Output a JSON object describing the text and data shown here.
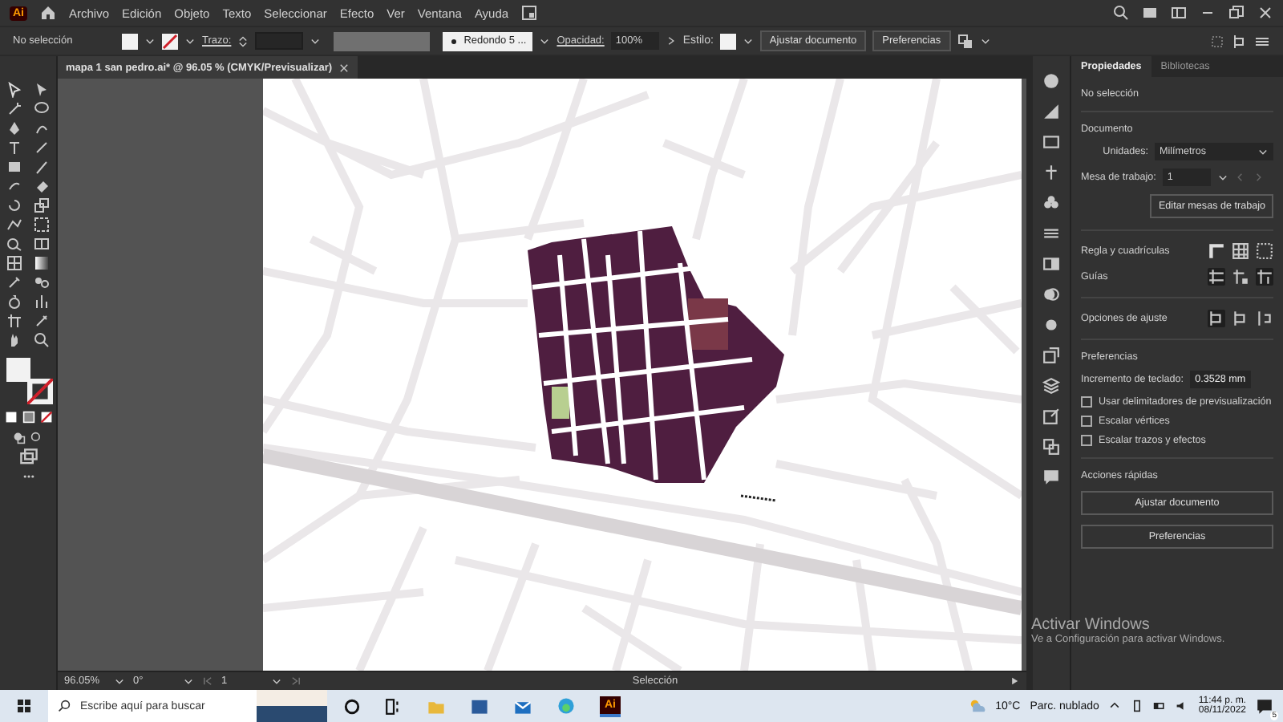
{
  "app": {
    "logo": "Ai",
    "menu": [
      "Archivo",
      "Edición",
      "Objeto",
      "Texto",
      "Seleccionar",
      "Efecto",
      "Ver",
      "Ventana",
      "Ayuda"
    ]
  },
  "control_bar": {
    "selection": "No selección",
    "stroke_label": "Trazo:",
    "brush": "Redondo 5 ...",
    "opacity_label": "Opacidad:",
    "opacity": "100%",
    "style_label": "Estilo:",
    "buttons": [
      "Ajustar documento",
      "Preferencias"
    ]
  },
  "document_tab": {
    "title": "mapa 1 san pedro.ai* @ 96.05 % (CMYK/Previsualizar)"
  },
  "panel": {
    "tabs": [
      {
        "label": "Propiedades",
        "selected": true
      },
      {
        "label": "Bibliotecas",
        "selected": false
      }
    ],
    "selection": "No selección",
    "document_heading": "Documento",
    "units_label": "Unidades:",
    "units": "Milímetros",
    "artboard_label": "Mesa de trabajo:",
    "artboard": "1",
    "edit_artboards": "Editar mesas de trabajo",
    "rulers_label": "Regla y cuadrículas",
    "guides_label": "Guías",
    "snap_label": "Opciones de ajuste",
    "preferences_heading": "Preferencias",
    "keyboard_increment_label": "Incremento de teclado:",
    "keyboard_increment": "0.3528 mm",
    "options": [
      {
        "label": "Usar delimitadores de previsualización",
        "checked": false
      },
      {
        "label": "Escalar vértices",
        "checked": false
      },
      {
        "label": "Escalar trazos y efectos",
        "checked": false
      }
    ],
    "quick_actions_heading": "Acciones rápidas",
    "quick_actions": [
      "Ajustar documento",
      "Preferencias"
    ]
  },
  "status_bar": {
    "zoom": "96.05%",
    "rotation": "0°",
    "artboard": "1",
    "tool": "Selección"
  },
  "activation_notice": {
    "title": "Activar Windows",
    "message": "Ve a Configuración para activar Windows."
  },
  "taskbar": {
    "search_placeholder": "Escribe aquí para buscar",
    "app_label": "Ai",
    "temperature": "10°C",
    "weather": "Parc. nublado",
    "time": "11:44 p. m.",
    "date": "08/11/2022",
    "notifications": "5"
  }
}
